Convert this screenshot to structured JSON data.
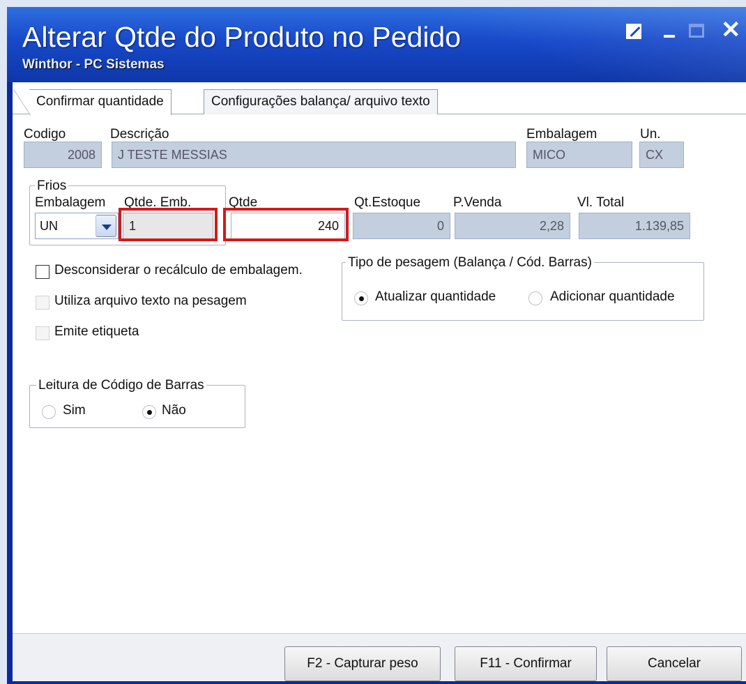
{
  "window": {
    "title": "Alterar Qtde do Produto no Pedido",
    "subtitle": "Winthor - PC Sistemas"
  },
  "tabs": [
    {
      "label": "Confirmar quantidade",
      "active": true
    },
    {
      "label": "Configurações balança/ arquivo texto",
      "active": false
    }
  ],
  "product": {
    "codigo_label": "Codigo",
    "codigo_value": "2008",
    "descricao_label": "Descrição",
    "descricao_value": "J TESTE MESSIAS",
    "embalagem_label": "Embalagem",
    "embalagem_value": "MICO",
    "un_label": "Un.",
    "un_value": "CX"
  },
  "frios": {
    "group_label": "Frios",
    "embalagem_label": "Embalagem",
    "embalagem_value": "UN",
    "qtde_emb_label": "Qtde. Emb.",
    "qtde_emb_value": "1"
  },
  "qty": {
    "qtde_label": "Qtde",
    "qtde_value": "240",
    "estoque_label": "Qt.Estoque",
    "estoque_value": "0",
    "pvenda_label": "P.Venda",
    "pvenda_value": "2,28",
    "vltotal_label": "Vl. Total",
    "vltotal_value": "1.139,85"
  },
  "options": {
    "desconsiderar": {
      "label": "Desconsiderar o recálculo de embalagem.",
      "checked": false,
      "enabled": true
    },
    "arquivo_texto": {
      "label": "Utiliza arquivo texto na pesagem",
      "checked": false,
      "enabled": false
    },
    "etiqueta": {
      "label": "Emite etiqueta",
      "checked": false,
      "enabled": false
    }
  },
  "pesagem": {
    "group_label": "Tipo de pesagem (Balança / Cód. Barras)",
    "atualizar_label": "Atualizar quantidade",
    "adicionar_label": "Adicionar quantidade",
    "selected": "atualizar"
  },
  "barras": {
    "group_label": "Leitura de Código de Barras",
    "sim_label": "Sim",
    "nao_label": "Não",
    "selected": "nao"
  },
  "buttons": {
    "capturar": "F2 - Capturar peso",
    "confirmar": "F11 - Confirmar",
    "cancelar": "Cancelar"
  },
  "colors": {
    "title_bar": "#1749c9",
    "highlight": "#d21a1a",
    "readonly_field": "#c3cfde"
  }
}
